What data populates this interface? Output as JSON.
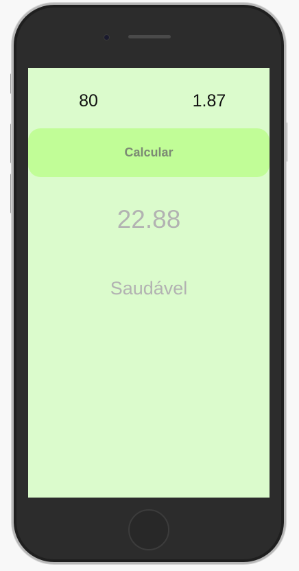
{
  "form": {
    "weight_value": "80",
    "height_value": "1.87",
    "calculate_label": "Calcular"
  },
  "result": {
    "bmi_value": "22.88",
    "classification": "Saudável"
  },
  "colors": {
    "screen_background": "#dbfbcc",
    "button_background": "#c1fd97",
    "result_text": "#b2b2b2"
  }
}
